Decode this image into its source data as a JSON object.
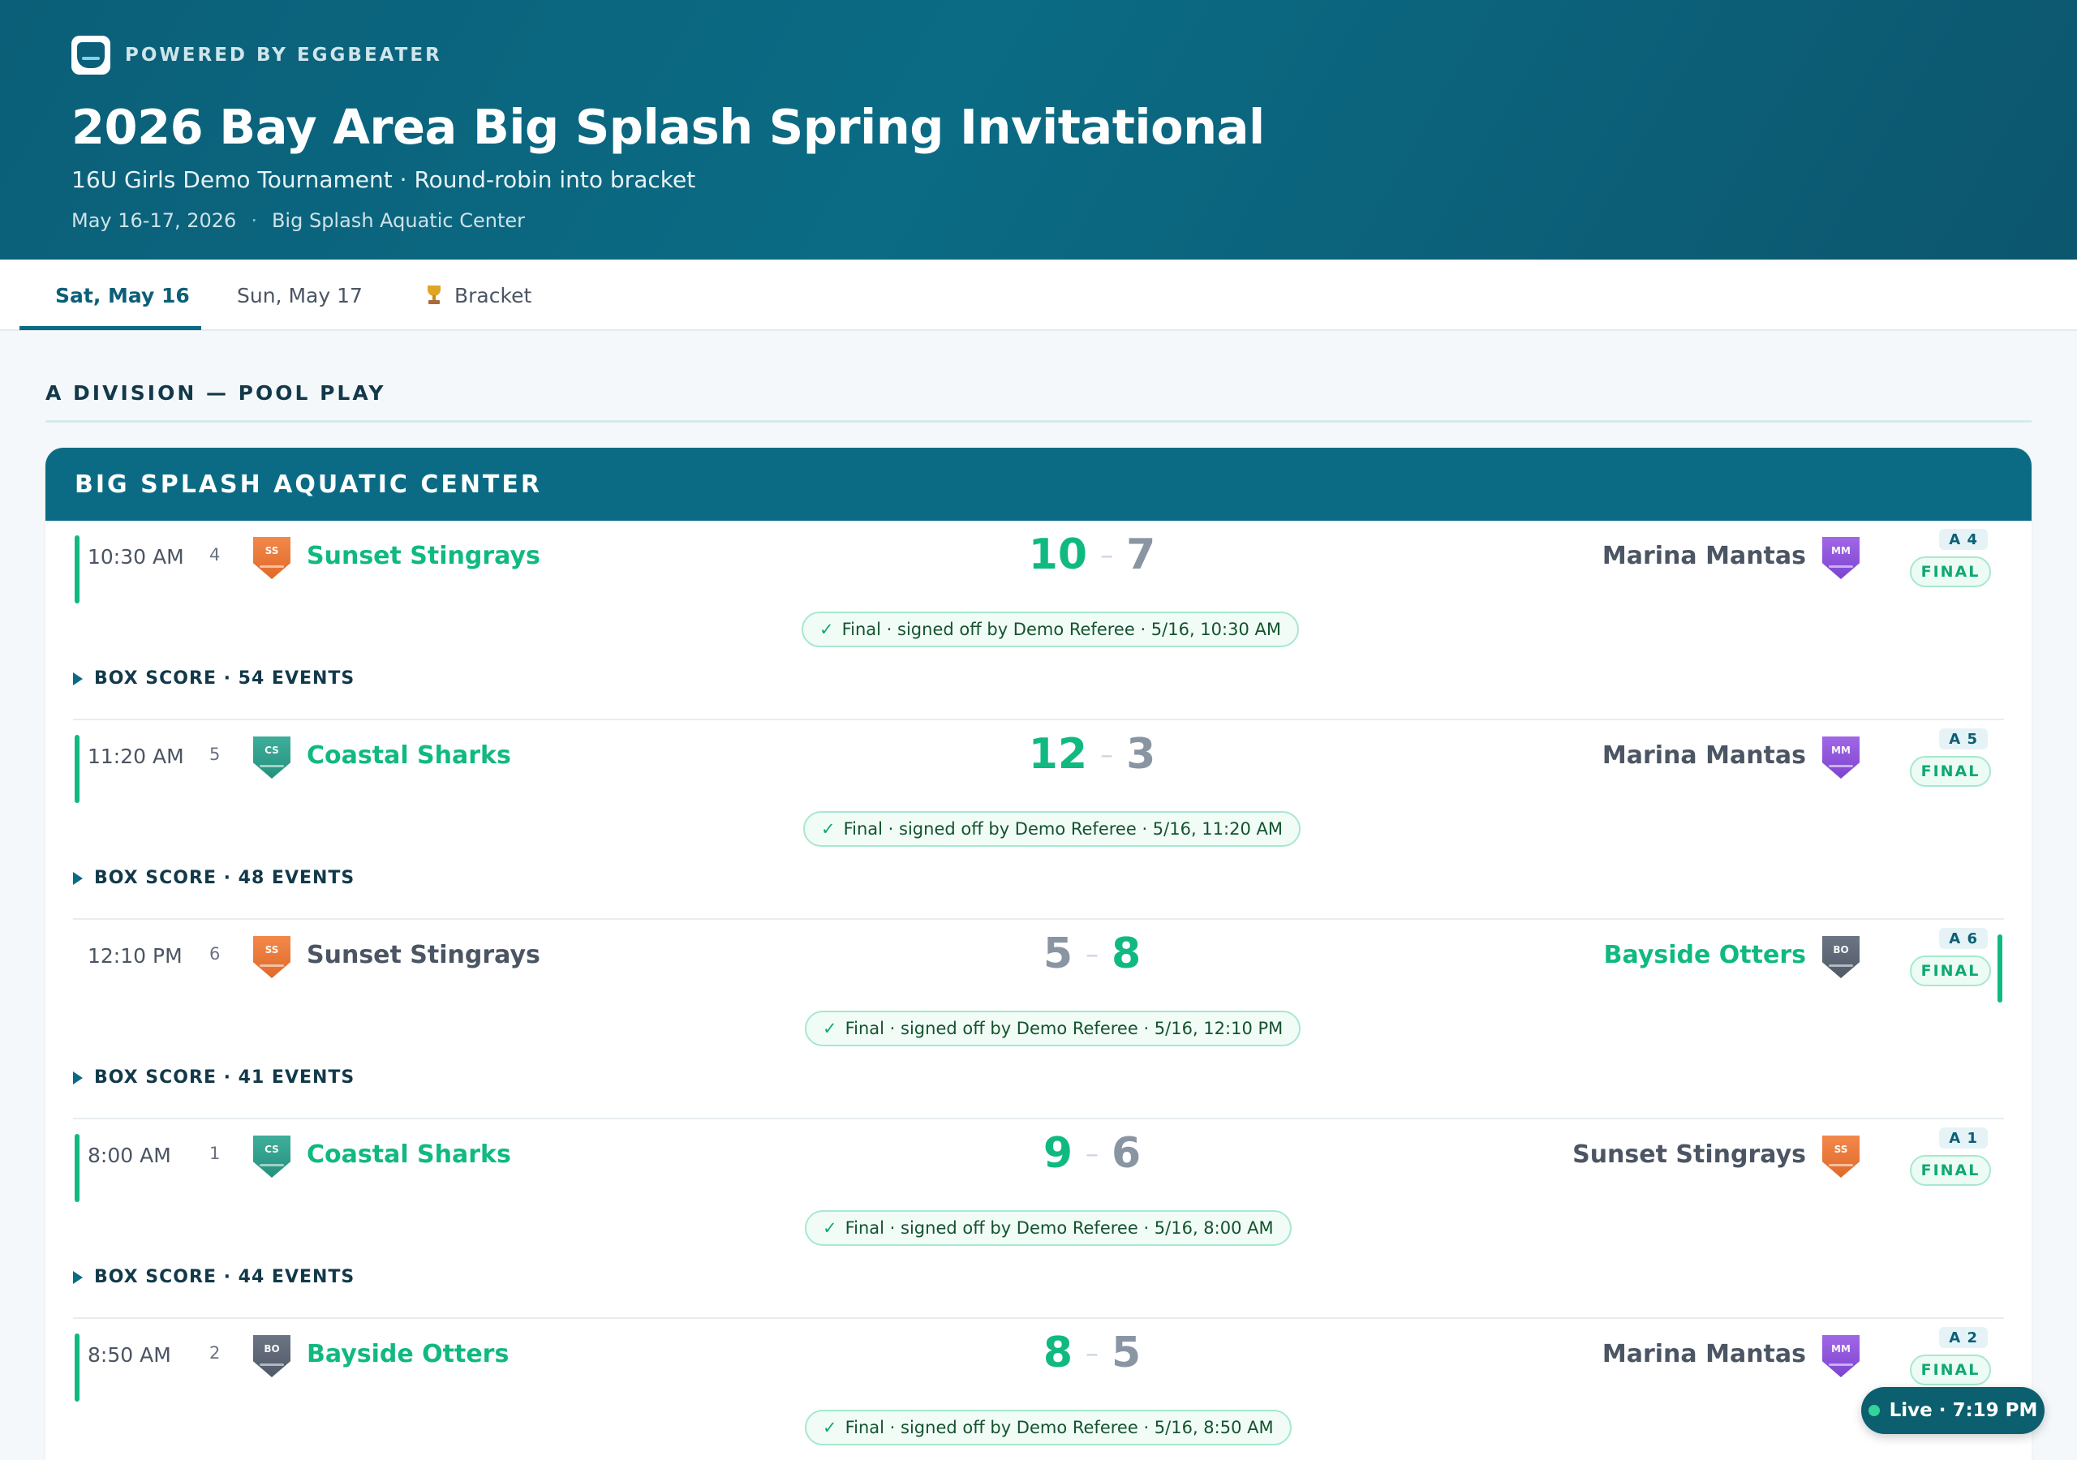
{
  "header": {
    "powered_by": "POWERED BY EGGBEATER",
    "title": "2026 Bay Area Big Splash Spring Invitational",
    "subtitle": "16U Girls Demo Tournament · Round-robin into bracket",
    "dates": "May 16-17, 2026",
    "separator": "·",
    "venue": "Big Splash Aquatic Center"
  },
  "tabs": [
    {
      "label": "Sat, May 16",
      "active": true
    },
    {
      "label": "Sun, May 17",
      "active": false
    },
    {
      "label": "Bracket",
      "active": false,
      "icon": "trophy-icon"
    }
  ],
  "division": "A DIVISION — POOL PLAY",
  "venue_card": {
    "title": "BIG SPLASH AQUATIC CENTER",
    "games": [
      {
        "time": "10:30 AM",
        "number": "4",
        "home": "Sunset Stingrays",
        "home_initials": "SS",
        "home_score": "10",
        "away": "Marina Mantas",
        "away_initials": "MM",
        "away_score": "7",
        "code": "A 4",
        "status": "FINAL",
        "signoff": "Final · signed off by Demo Referee · 5/16, 10:30 AM",
        "box_score": "BOX SCORE · 54 EVENTS",
        "winner": "home"
      },
      {
        "time": "11:20 AM",
        "number": "5",
        "home": "Coastal Sharks",
        "home_initials": "CS",
        "home_score": "12",
        "away": "Marina Mantas",
        "away_initials": "MM",
        "away_score": "3",
        "code": "A 5",
        "status": "FINAL",
        "signoff": "Final · signed off by Demo Referee · 5/16, 11:20 AM",
        "box_score": "BOX SCORE · 48 EVENTS",
        "winner": "home"
      },
      {
        "time": "12:10 PM",
        "number": "6",
        "home": "Sunset Stingrays",
        "home_initials": "SS",
        "home_score": "5",
        "away": "Bayside Otters",
        "away_initials": "BO",
        "away_score": "8",
        "code": "A 6",
        "status": "FINAL",
        "signoff": "Final · signed off by Demo Referee · 5/16, 12:10 PM",
        "box_score": "BOX SCORE · 41 EVENTS",
        "winner": "away"
      },
      {
        "time": "8:00 AM",
        "number": "1",
        "home": "Coastal Sharks",
        "home_initials": "CS",
        "home_score": "9",
        "away": "Sunset Stingrays",
        "away_initials": "SS",
        "away_score": "6",
        "code": "A 1",
        "status": "FINAL",
        "signoff": "Final · signed off by Demo Referee · 5/16, 8:00 AM",
        "box_score": "BOX SCORE · 44 EVENTS",
        "winner": "home"
      },
      {
        "time": "8:50 AM",
        "number": "2",
        "home": "Bayside Otters",
        "home_initials": "BO",
        "home_score": "8",
        "away": "Marina Mantas",
        "away_initials": "MM",
        "away_score": "5",
        "code": "A 2",
        "status": "FINAL",
        "signoff": "Final · signed off by Demo Referee · 5/16, 8:50 AM",
        "box_score": "",
        "winner": "home"
      }
    ]
  },
  "live": {
    "label": "Live · 7:19 PM"
  },
  "colors": {
    "brand": "#0b6b84",
    "win": "#10b981",
    "lose": "#4b5563"
  }
}
